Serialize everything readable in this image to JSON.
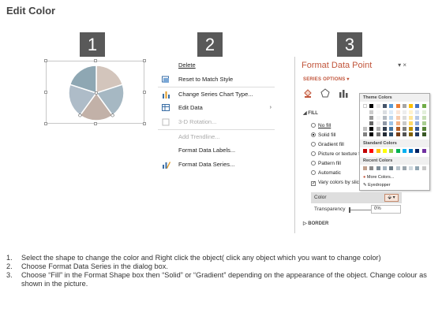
{
  "page_title": "Edit Color",
  "step_badges": [
    "1",
    "2",
    "3"
  ],
  "pie": {
    "colors": [
      "#d3c5bc",
      "#a6b8c3",
      "#c2b1a8",
      "#aebcc8",
      "#8ea7b3"
    ]
  },
  "context_menu": {
    "items": [
      {
        "label": "Delete",
        "icon": "delete-icon",
        "enabled": true
      },
      {
        "label": "Reset to Match Style",
        "icon": "reset-style-icon",
        "enabled": true
      },
      {
        "label": "Change Series Chart Type...",
        "icon": "chart-type-icon",
        "enabled": true
      },
      {
        "label": "Edit Data",
        "icon": "edit-data-icon",
        "enabled": true,
        "submenu": true
      },
      {
        "label": "3-D Rotation...",
        "icon": "rotation-icon",
        "enabled": false
      },
      {
        "label": "Add Trendline...",
        "icon": "",
        "enabled": false
      },
      {
        "label": "Format Data Labels...",
        "icon": "",
        "enabled": true
      },
      {
        "label": "Format Data Series...",
        "icon": "format-series-icon",
        "enabled": true
      }
    ],
    "submenu_arrow": "›"
  },
  "format_pane": {
    "title": "Format Data Point",
    "close": "▾ ×",
    "series_options": "SERIES OPTIONS ▾",
    "fill_header": "◢ FILL",
    "fill_options": [
      "No fill",
      "Solid fill",
      "Gradient fill",
      "Picture or texture fi",
      "Pattern fill",
      "Automatic"
    ],
    "selected_fill": "Solid fill",
    "vary_colors": "Vary colors by slice",
    "color_label": "Color",
    "color_button": "⬙ ▾",
    "transparency_label": "Transparency",
    "transparency_value": "0%",
    "border_header": "▷ BORDER"
  },
  "color_picker": {
    "theme_colors_label": "Theme Colors",
    "standard_colors_label": "Standard Colors",
    "recent_colors_label": "Recent Colors",
    "more_colors": "More Colors...",
    "eyedropper": "Eyedropper",
    "theme_top": [
      "#ffffff",
      "#000000",
      "#e7e6e6",
      "#44546a",
      "#5b9bd5",
      "#ed7d31",
      "#a5a5a5",
      "#ffc000",
      "#4472c4",
      "#70ad47"
    ],
    "standard": [
      "#c00000",
      "#ff0000",
      "#ffc000",
      "#ffff00",
      "#92d050",
      "#00b050",
      "#00b0f0",
      "#0070c0",
      "#002060",
      "#7030a0"
    ],
    "recent": [
      "#c2a18d",
      "#8a8a8a",
      "#7d8c96",
      "#a4b3be",
      "#6b7b86",
      "#b7c3cb",
      "#9aa5ad",
      "#cfd8de",
      "#8fa4b1",
      "#c8c8c8"
    ]
  },
  "instructions": [
    {
      "num": "1.",
      "text": "Select the shape to change the color and Right click the object( click any object which you want to change color)"
    },
    {
      "num": "2.",
      "text": "Choose Format Data Series in the dialog box."
    },
    {
      "num": "3.",
      "text": "Choose “Fill” in the Format Shape box then  “Solid” or “Gradient” depending on the appearance of the object. Change colour as shown in the picture."
    }
  ]
}
